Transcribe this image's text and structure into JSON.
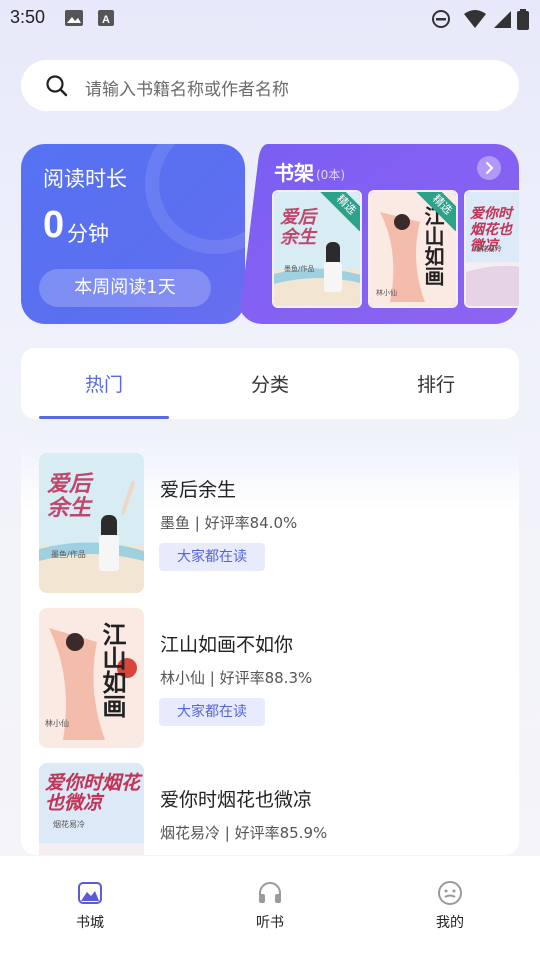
{
  "status_bar": {
    "time": "3:50"
  },
  "search": {
    "placeholder": "请输入书籍名称或作者名称"
  },
  "reading": {
    "title": "阅读时长",
    "value": "0",
    "unit": "分钟",
    "week_button": "本周阅读1天"
  },
  "shelf": {
    "title": "书架",
    "count": "(0本)",
    "badge": "精选",
    "books": [
      {
        "cover_text": "爱后余生",
        "author_line": "墨鱼/作品"
      },
      {
        "cover_text": "江山如画",
        "author_line": "林小仙"
      },
      {
        "cover_text": "爱你时烟花也微凉",
        "author_line": "烟花易冷"
      }
    ]
  },
  "tabs": [
    {
      "label": "热门"
    },
    {
      "label": "分类"
    },
    {
      "label": "排行"
    }
  ],
  "books": [
    {
      "title": "爱后余生",
      "meta": "墨鱼 | 好评率84.0%",
      "tag": "大家都在读",
      "cover_text": "爱后余生",
      "cover_author": "墨鱼/作品"
    },
    {
      "title": "江山如画不如你",
      "meta": "林小仙 | 好评率88.3%",
      "tag": "大家都在读",
      "cover_text": "江山如画",
      "cover_author": "林小仙"
    },
    {
      "title": "爱你时烟花也微凉",
      "meta": "烟花易冷 | 好评率85.9%",
      "tag": "",
      "cover_text": "爱你时烟花也微凉",
      "cover_author": "烟花易冷"
    }
  ],
  "bottom_nav": [
    {
      "label": "书城"
    },
    {
      "label": "听书"
    },
    {
      "label": "我的"
    }
  ],
  "colors": {
    "accent": "#5869e8",
    "reading_card": "#5672f2",
    "shelf_card": "#8462f2",
    "badge": "#2aa38a"
  }
}
